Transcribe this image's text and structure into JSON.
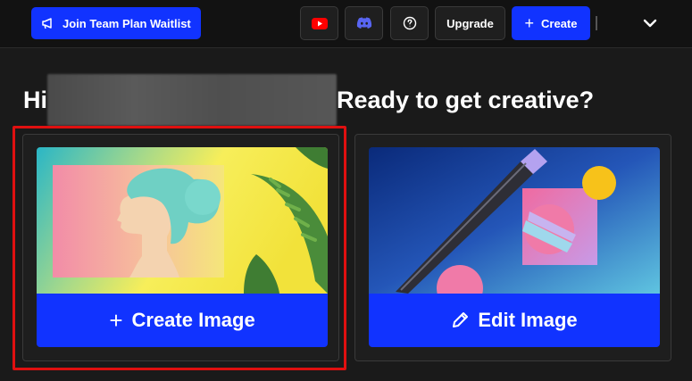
{
  "topbar": {
    "waitlist_label": "Join Team Plan Waitlist",
    "youtube_icon": "youtube-icon",
    "discord_icon": "discord-icon",
    "help_icon": "help-circle-icon",
    "upgrade_label": "Upgrade",
    "create_label": "Create",
    "menu_icon": "chevron-down-icon",
    "colors": {
      "accent": "#1133ff",
      "youtube": "#ff0000",
      "discord": "#5865f2"
    }
  },
  "greeting": {
    "prefix": "Hi",
    "suffix": "Ready to get creative?"
  },
  "cards": [
    {
      "action_label": "Create Image",
      "icon": "plus-icon"
    },
    {
      "action_label": "Edit Image",
      "icon": "pencil-icon"
    }
  ],
  "highlight_color": "#e01010"
}
